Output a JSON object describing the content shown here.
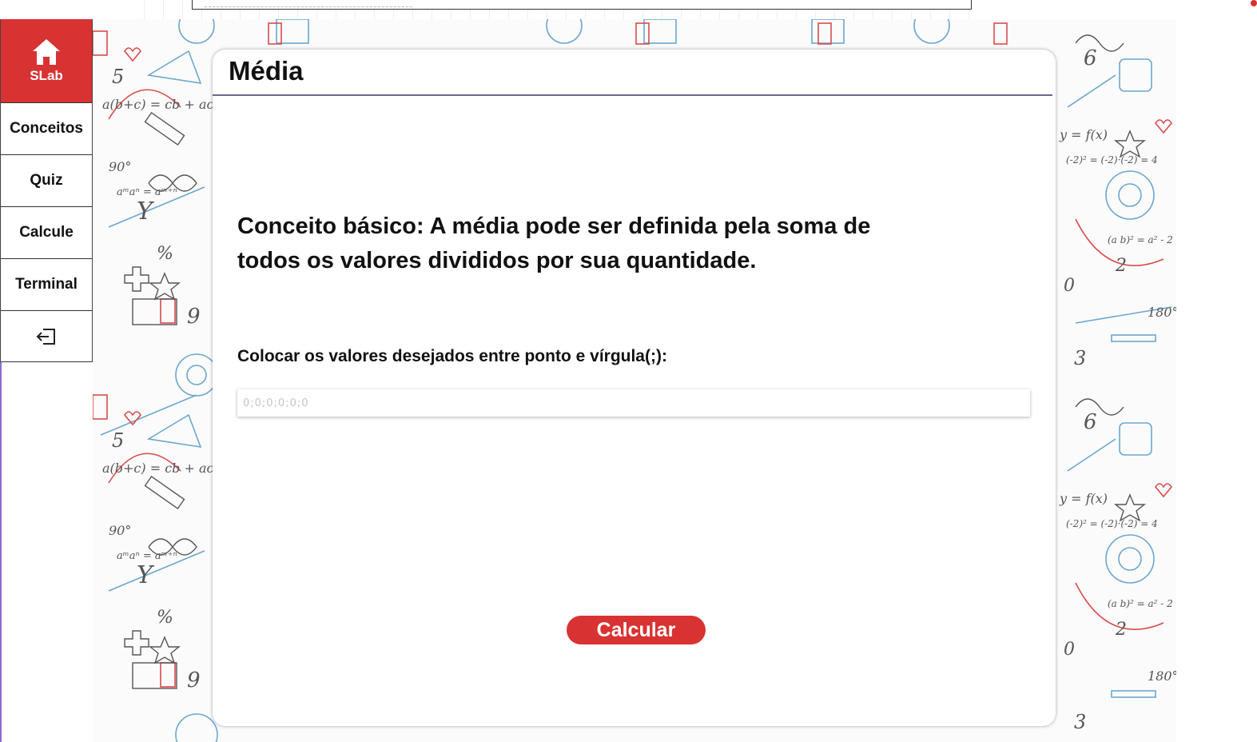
{
  "sidebar": {
    "home": {
      "icon": "home-icon",
      "label": "SLab"
    },
    "items": [
      {
        "label": "Conceitos"
      },
      {
        "label": "Quiz"
      },
      {
        "label": "Calcule"
      },
      {
        "label": "Terminal"
      }
    ],
    "logout": {
      "icon": "logout-icon"
    }
  },
  "main": {
    "title": "Média",
    "concept": "Conceito básico: A média pode ser definida pela soma de todos os valores divididos por sua quantidade.",
    "hint": "Colocar os valores desejados entre ponto e vírgula(;):",
    "input": {
      "placeholder": "0;0;0;0;0;0",
      "value": ""
    },
    "calculate_label": "Calcular"
  },
  "colors": {
    "accent": "#d93232",
    "text": "#111111",
    "card": "#ffffff"
  }
}
